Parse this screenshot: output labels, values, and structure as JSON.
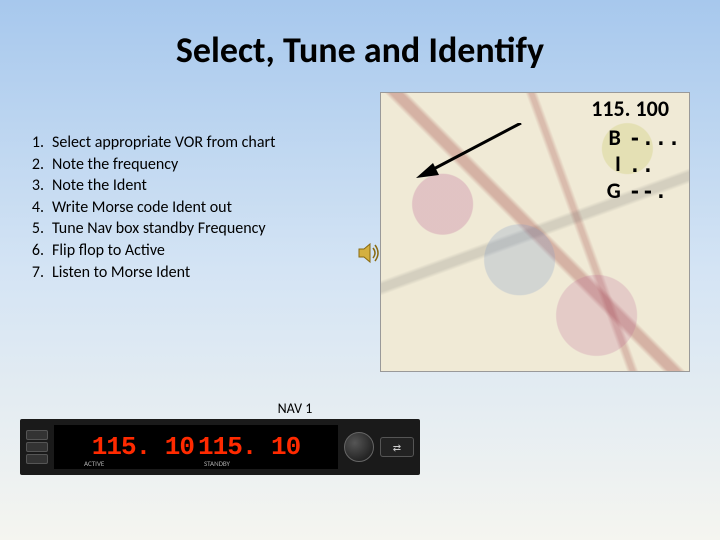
{
  "title": "Select, Tune and Identify",
  "steps": [
    "Select appropriate VOR from chart",
    "Note the frequency",
    "Note the Ident",
    "Write Morse code Ident out",
    "Tune Nav box standby Frequency",
    "Flip flop to Active",
    "Listen to Morse Ident"
  ],
  "chart": {
    "frequency": "115. 100",
    "morse": [
      {
        "letter": "B",
        "code": "-..."
      },
      {
        "letter": "I",
        "code": ".."
      },
      {
        "letter": "G",
        "code": "--."
      }
    ]
  },
  "nav": {
    "label": "NAV 1",
    "active": "115. 10 ",
    "standby": "115. 10",
    "active_label": "ACTIVE",
    "standby_label": "STANDBY",
    "flip": "⇄"
  }
}
